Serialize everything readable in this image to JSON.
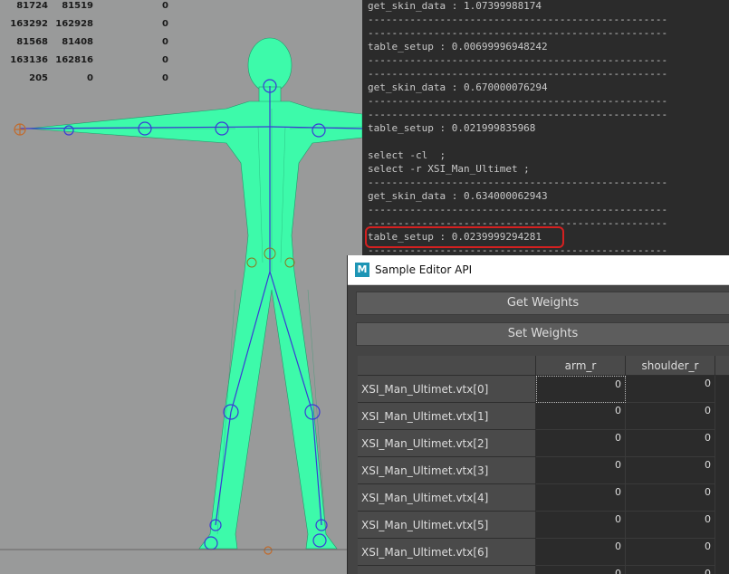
{
  "viewport": {
    "stats": [
      [
        "81724",
        "81519",
        "0"
      ],
      [
        "163292",
        "162928",
        "0"
      ],
      [
        "81568",
        "81408",
        "0"
      ],
      [
        "163136",
        "162816",
        "0"
      ],
      [
        "205",
        "0",
        "0"
      ]
    ],
    "mesh_color": "#3dfaaa"
  },
  "script_editor": {
    "lines": [
      "get_skin_data : 1.07399988174",
      "--------------------------------------------------",
      "--------------------------------------------------",
      "table_setup : 0.00699996948242",
      "--------------------------------------------------",
      "--------------------------------------------------",
      "get_skin_data : 0.670000076294",
      "--------------------------------------------------",
      "--------------------------------------------------",
      "table_setup : 0.021999835968",
      "select -cl  ;",
      "select -r XSI_Man_Ultimet ;",
      "--------------------------------------------------",
      "get_skin_data : 0.634000062943",
      "--------------------------------------------------",
      "--------------------------------------------------",
      "table_setup : 0.0239999294281",
      "--------------------------------------------------"
    ],
    "highlight_color": "#d42020"
  },
  "editor": {
    "logo": "M",
    "title": "Sample Editor API",
    "get_weights_label": "Get Weights",
    "set_weights_label": "Set Weights",
    "columns": [
      "arm_r",
      "shoulder_r"
    ],
    "rows": [
      {
        "name": "XSI_Man_Ultimet.vtx[0]",
        "values": [
          "0",
          "0"
        ]
      },
      {
        "name": "XSI_Man_Ultimet.vtx[1]",
        "values": [
          "0",
          "0"
        ]
      },
      {
        "name": "XSI_Man_Ultimet.vtx[2]",
        "values": [
          "0",
          "0"
        ]
      },
      {
        "name": "XSI_Man_Ultimet.vtx[3]",
        "values": [
          "0",
          "0"
        ]
      },
      {
        "name": "XSI_Man_Ultimet.vtx[4]",
        "values": [
          "0",
          "0"
        ]
      },
      {
        "name": "XSI_Man_Ultimet.vtx[5]",
        "values": [
          "0",
          "0"
        ]
      },
      {
        "name": "XSI_Man_Ultimet.vtx[6]",
        "values": [
          "0",
          "0"
        ]
      },
      {
        "name": "",
        "values": [
          "0",
          "0"
        ]
      }
    ]
  }
}
